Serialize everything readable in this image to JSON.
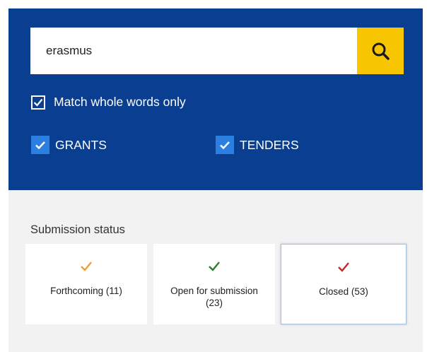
{
  "search": {
    "value": "erasmus",
    "button_icon": "search-icon"
  },
  "options": {
    "match_whole_words": {
      "label": "Match whole words only",
      "checked": true
    },
    "grants": {
      "label": "GRANTS",
      "checked": true
    },
    "tenders": {
      "label": "TENDERS",
      "checked": true
    }
  },
  "submission_status": {
    "title": "Submission status",
    "items": [
      {
        "label": "Forthcoming (11)",
        "check_color": "#f0a030"
      },
      {
        "label": "Open for submission (23)",
        "check_color": "#2e7d32"
      },
      {
        "label": "Closed (53)",
        "check_color": "#c62828"
      }
    ]
  },
  "colors": {
    "panel": "#0a3e91",
    "search_button": "#f7c600",
    "checkbox_fill": "#2a7fe0",
    "lower_background": "#f2f2f2"
  }
}
